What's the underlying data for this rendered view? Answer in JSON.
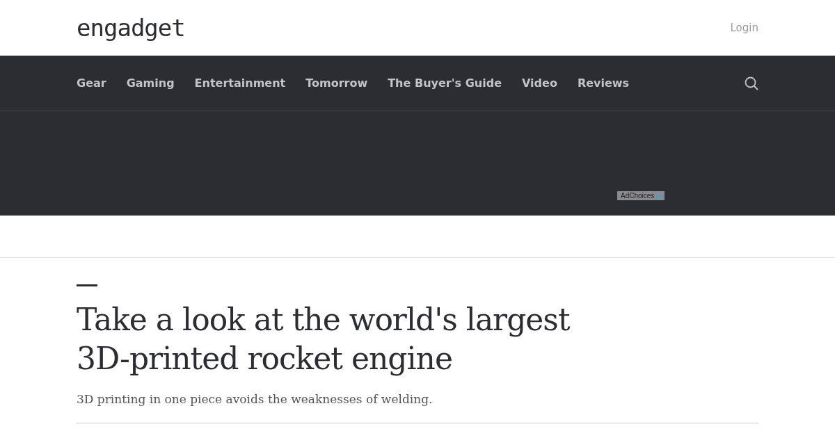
{
  "header": {
    "logo": "engadget",
    "login": "Login"
  },
  "nav": {
    "items": [
      {
        "label": "Gear"
      },
      {
        "label": "Gaming"
      },
      {
        "label": "Entertainment"
      },
      {
        "label": "Tomorrow"
      },
      {
        "label": "The Buyer's Guide"
      },
      {
        "label": "Video"
      },
      {
        "label": "Reviews"
      }
    ]
  },
  "ad": {
    "label": "AdChoices"
  },
  "article": {
    "title": "Take a look at the world's largest 3D-printed rocket engine",
    "subtitle": "3D printing in one piece avoids the weaknesses of welding."
  }
}
